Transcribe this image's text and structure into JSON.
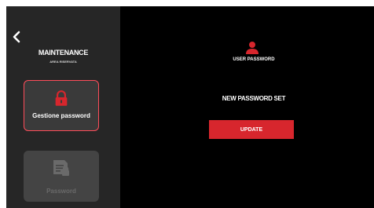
{
  "sidebar": {
    "title": "MAINTENANCE",
    "subtitle": "AREA RISERVATA",
    "items": [
      {
        "label": "Gestione password",
        "icon": "lock-icon",
        "state": "active"
      },
      {
        "label": "Password",
        "icon": "document-lock-icon",
        "state": "disabled"
      }
    ]
  },
  "main": {
    "user_icon": "user-icon",
    "section_label": "USER PASSWORD",
    "status_text": "NEW PASSWORD SET",
    "update_button": "UPDATE"
  },
  "colors": {
    "accent": "#d7262d",
    "sidebar_bg": "#262626",
    "screen_bg": "#000000"
  }
}
